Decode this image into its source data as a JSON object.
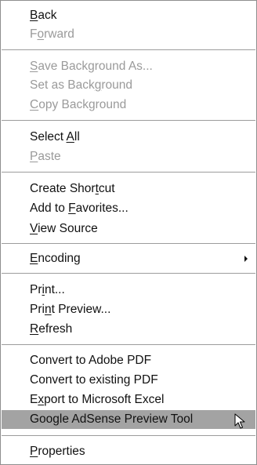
{
  "menu": {
    "items": [
      {
        "pre": "",
        "acc": "B",
        "post": "ack",
        "disabled": false
      },
      {
        "pre": "F",
        "acc": "o",
        "post": "rward",
        "disabled": true
      },
      {
        "pre": "",
        "acc": "S",
        "post": "ave Background As...",
        "disabled": true
      },
      {
        "pre": "Set as Back",
        "acc": "g",
        "post": "round",
        "disabled": true
      },
      {
        "pre": "",
        "acc": "C",
        "post": "opy Background",
        "disabled": true
      },
      {
        "pre": "Select ",
        "acc": "A",
        "post": "ll",
        "disabled": false
      },
      {
        "pre": "",
        "acc": "P",
        "post": "aste",
        "disabled": true
      },
      {
        "pre": "Create Shor",
        "acc": "t",
        "post": "cut",
        "disabled": false
      },
      {
        "pre": "Add to ",
        "acc": "F",
        "post": "avorites...",
        "disabled": false
      },
      {
        "pre": "",
        "acc": "V",
        "post": "iew Source",
        "disabled": false
      },
      {
        "pre": "",
        "acc": "E",
        "post": "ncoding",
        "disabled": false,
        "submenu": true
      },
      {
        "pre": "Pr",
        "acc": "i",
        "post": "nt...",
        "disabled": false
      },
      {
        "pre": "Pri",
        "acc": "n",
        "post": "t Preview...",
        "disabled": false
      },
      {
        "pre": "",
        "acc": "R",
        "post": "efresh",
        "disabled": false
      },
      {
        "pre": "Convert to Adobe PDF",
        "acc": "",
        "post": "",
        "disabled": false
      },
      {
        "pre": "Convert to existing PDF",
        "acc": "",
        "post": "",
        "disabled": false
      },
      {
        "pre": "E",
        "acc": "x",
        "post": "port to Microsoft Excel",
        "disabled": false
      },
      {
        "pre": "Google AdSense Preview Tool",
        "acc": "",
        "post": "",
        "disabled": false,
        "highlighted": true
      },
      {
        "pre": "",
        "acc": "P",
        "post": "roperties",
        "disabled": false
      }
    ]
  }
}
